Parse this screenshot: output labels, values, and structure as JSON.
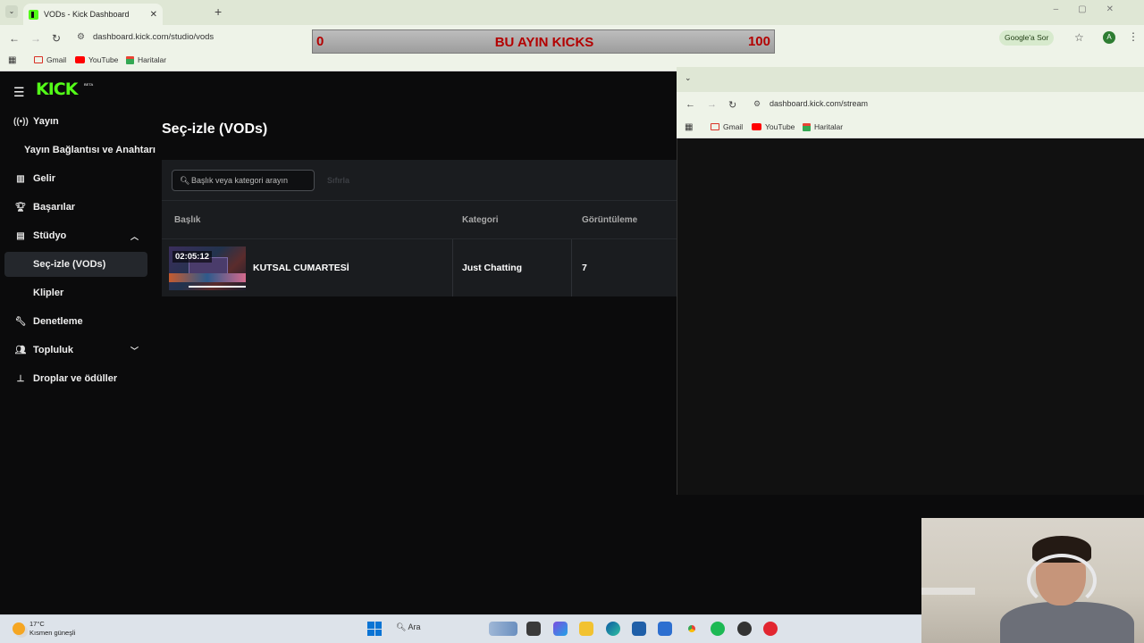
{
  "browser": {
    "tab_title": "VODs - Kick Dashboard",
    "tab_close": "✕",
    "new_tab": "+",
    "url": "dashboard.kick.com/studio/vods",
    "google_ask": "Google'a Sor",
    "profile_initial": "A",
    "bookmarks": [
      "Gmail",
      "YouTube",
      "Haritalar"
    ]
  },
  "overlay": {
    "left_value": "0",
    "title": "BU AYIN KICKS",
    "right_value": "100"
  },
  "logo": "KICK",
  "logo_badge": "BETA",
  "sidebar": {
    "items": [
      {
        "label": "Yayın",
        "icon": "broadcast-icon"
      },
      {
        "label": "Yayın Bağlantısı ve Anahtarı",
        "icon": ""
      },
      {
        "label": "Gelir",
        "icon": "chart-icon"
      },
      {
        "label": "Başarılar",
        "icon": "trophy-icon"
      },
      {
        "label": "Stüdyo",
        "icon": "studio-icon"
      },
      {
        "label": "Seç-izle (VODs)",
        "icon": ""
      },
      {
        "label": "Klipler",
        "icon": ""
      },
      {
        "label": "Denetleme",
        "icon": "wrench-icon"
      },
      {
        "label": "Topluluk",
        "icon": "users-icon"
      },
      {
        "label": "Droplar ve ödüller",
        "icon": "drops-icon"
      }
    ]
  },
  "main": {
    "page_title": "Seç-izle (VODs)",
    "search_placeholder": "Başlık veya kategori arayın",
    "ghost_button": "Sıfırla",
    "columns": [
      "Başlık",
      "Kategori",
      "Görüntüleme"
    ],
    "rows": [
      {
        "duration": "02:05:12",
        "title": "KUTSAL CUMARTESİ",
        "category": "Just Chatting",
        "views": "7"
      }
    ]
  },
  "second_window": {
    "url": "dashboard.kick.com/stream",
    "bookmarks": [
      "Gmail",
      "YouTube",
      "Haritalar"
    ]
  },
  "taskbar": {
    "temperature": "17°C",
    "weather": "Kısmen güneşli",
    "search": "Ara"
  }
}
